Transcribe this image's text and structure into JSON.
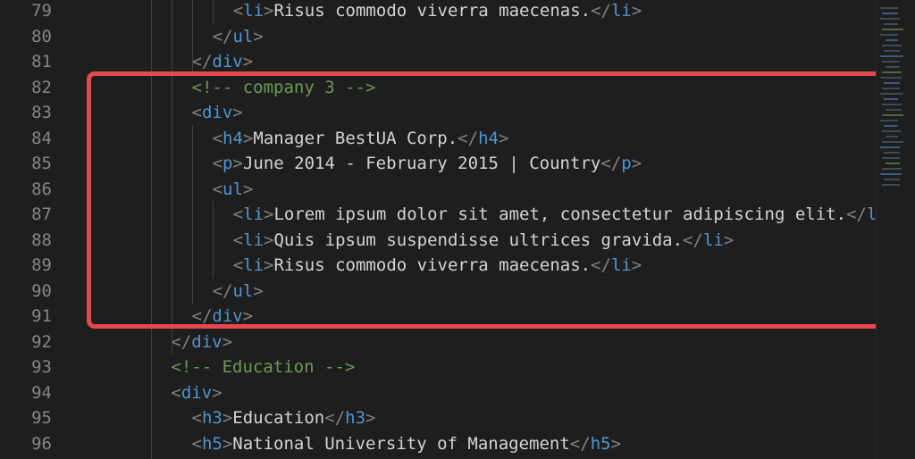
{
  "editor": {
    "lines": [
      {
        "num": "79",
        "indent": 11,
        "parts": [
          [
            "br",
            "<"
          ],
          [
            "tag",
            "li"
          ],
          [
            "br",
            ">"
          ],
          [
            "txt",
            "Risus commodo viverra maecenas."
          ],
          [
            "br",
            "</"
          ],
          [
            "tag",
            "li"
          ],
          [
            "br",
            ">"
          ]
        ]
      },
      {
        "num": "80",
        "indent": 10,
        "parts": [
          [
            "br",
            "</"
          ],
          [
            "tag",
            "ul"
          ],
          [
            "br",
            ">"
          ]
        ]
      },
      {
        "num": "81",
        "indent": 9,
        "parts": [
          [
            "br",
            "</"
          ],
          [
            "tag",
            "div"
          ],
          [
            "br",
            ">"
          ]
        ]
      },
      {
        "num": "82",
        "indent": 9,
        "parts": [
          [
            "cmt",
            "<!-- company 3 -->"
          ]
        ]
      },
      {
        "num": "83",
        "indent": 9,
        "parts": [
          [
            "br",
            "<"
          ],
          [
            "tag",
            "div"
          ],
          [
            "br",
            ">"
          ]
        ]
      },
      {
        "num": "84",
        "indent": 10,
        "parts": [
          [
            "br",
            "<"
          ],
          [
            "tag",
            "h4"
          ],
          [
            "br",
            ">"
          ],
          [
            "txt",
            "Manager BestUA Corp."
          ],
          [
            "br",
            "</"
          ],
          [
            "tag",
            "h4"
          ],
          [
            "br",
            ">"
          ]
        ]
      },
      {
        "num": "85",
        "indent": 10,
        "parts": [
          [
            "br",
            "<"
          ],
          [
            "tag",
            "p"
          ],
          [
            "br",
            ">"
          ],
          [
            "txt",
            "June 2014 - February 2015 | Country"
          ],
          [
            "br",
            "</"
          ],
          [
            "tag",
            "p"
          ],
          [
            "br",
            ">"
          ]
        ]
      },
      {
        "num": "86",
        "indent": 10,
        "parts": [
          [
            "br",
            "<"
          ],
          [
            "tag",
            "ul"
          ],
          [
            "br",
            ">"
          ]
        ]
      },
      {
        "num": "87",
        "indent": 11,
        "parts": [
          [
            "br",
            "<"
          ],
          [
            "tag",
            "li"
          ],
          [
            "br",
            ">"
          ],
          [
            "txt",
            "Lorem ipsum dolor sit amet, consectetur adipiscing elit."
          ],
          [
            "br",
            "</"
          ],
          [
            "tag",
            "l"
          ]
        ]
      },
      {
        "num": "88",
        "indent": 11,
        "parts": [
          [
            "br",
            "<"
          ],
          [
            "tag",
            "li"
          ],
          [
            "br",
            ">"
          ],
          [
            "txt",
            "Quis ipsum suspendisse ultrices gravida."
          ],
          [
            "br",
            "</"
          ],
          [
            "tag",
            "li"
          ],
          [
            "br",
            ">"
          ]
        ]
      },
      {
        "num": "89",
        "indent": 11,
        "parts": [
          [
            "br",
            "<"
          ],
          [
            "tag",
            "li"
          ],
          [
            "br",
            ">"
          ],
          [
            "txt",
            "Risus commodo viverra maecenas."
          ],
          [
            "br",
            "</"
          ],
          [
            "tag",
            "li"
          ],
          [
            "br",
            ">"
          ]
        ]
      },
      {
        "num": "90",
        "indent": 10,
        "parts": [
          [
            "br",
            "</"
          ],
          [
            "tag",
            "ul"
          ],
          [
            "br",
            ">"
          ]
        ]
      },
      {
        "num": "91",
        "indent": 9,
        "parts": [
          [
            "br",
            "</"
          ],
          [
            "tag",
            "div"
          ],
          [
            "br",
            ">"
          ]
        ]
      },
      {
        "num": "92",
        "indent": 8,
        "parts": [
          [
            "br",
            "</"
          ],
          [
            "tag",
            "div"
          ],
          [
            "br",
            ">"
          ]
        ]
      },
      {
        "num": "93",
        "indent": 8,
        "parts": [
          [
            "cmt",
            "<!-- Education -->"
          ]
        ]
      },
      {
        "num": "94",
        "indent": 8,
        "parts": [
          [
            "br",
            "<"
          ],
          [
            "tag",
            "div"
          ],
          [
            "br",
            ">"
          ]
        ]
      },
      {
        "num": "95",
        "indent": 9,
        "parts": [
          [
            "br",
            "<"
          ],
          [
            "tag",
            "h3"
          ],
          [
            "br",
            ">"
          ],
          [
            "txt",
            "Education"
          ],
          [
            "br",
            "</"
          ],
          [
            "tag",
            "h3"
          ],
          [
            "br",
            ">"
          ]
        ]
      },
      {
        "num": "96",
        "indent": 9,
        "parts": [
          [
            "br",
            "<"
          ],
          [
            "tag",
            "h5"
          ],
          [
            "br",
            ">"
          ],
          [
            "txt",
            "National University of Management"
          ],
          [
            "br",
            "</"
          ],
          [
            "tag",
            "h5"
          ],
          [
            "br",
            ">"
          ]
        ]
      }
    ]
  },
  "colors": {
    "background": "#1e1e1e",
    "tag": "#4f95d0",
    "bracket": "#808080",
    "text": "#d4d4d4",
    "comment": "#6a9955",
    "line_number": "#858585",
    "highlight": "#e5484d"
  }
}
